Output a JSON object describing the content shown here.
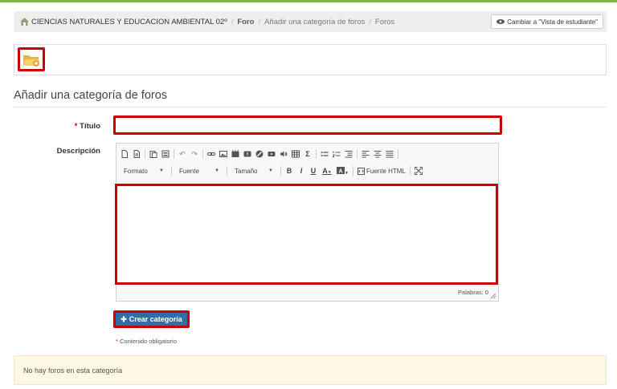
{
  "breadcrumb": {
    "course": "CIENCIAS NATURALES Y EDUCACION AMBIENTAL 02º",
    "forum": "Foro",
    "add_category": "Añadir una categoría de foros",
    "forums": "Foros"
  },
  "student_view_button": "Cambiar a \"Vista de estudiante\"",
  "toolbar": {
    "folder_icon": "folder-icon"
  },
  "page_title": "Añadir una categoría de foros",
  "form": {
    "required_mark": "*",
    "title_label": "Título",
    "title_value": "",
    "description_label": "Descripción",
    "editor": {
      "format_label": "Formato",
      "font_label": "Fuente",
      "size_label": "Tamaño",
      "bold": "B",
      "italic": "I",
      "underline": "U",
      "text_color": "A",
      "source_label": "Fuente HTML",
      "word_count": "Palabras: 0"
    },
    "submit_label": "Crear categoría",
    "mandatory_note": "Contenido obligatorio"
  },
  "notice": "No hay foros en esta categoría",
  "colors": {
    "accent": "#2f6ea8",
    "highlight": "#cc0000",
    "topline": "#7ab648",
    "notice_bg": "#fcf8e3"
  }
}
